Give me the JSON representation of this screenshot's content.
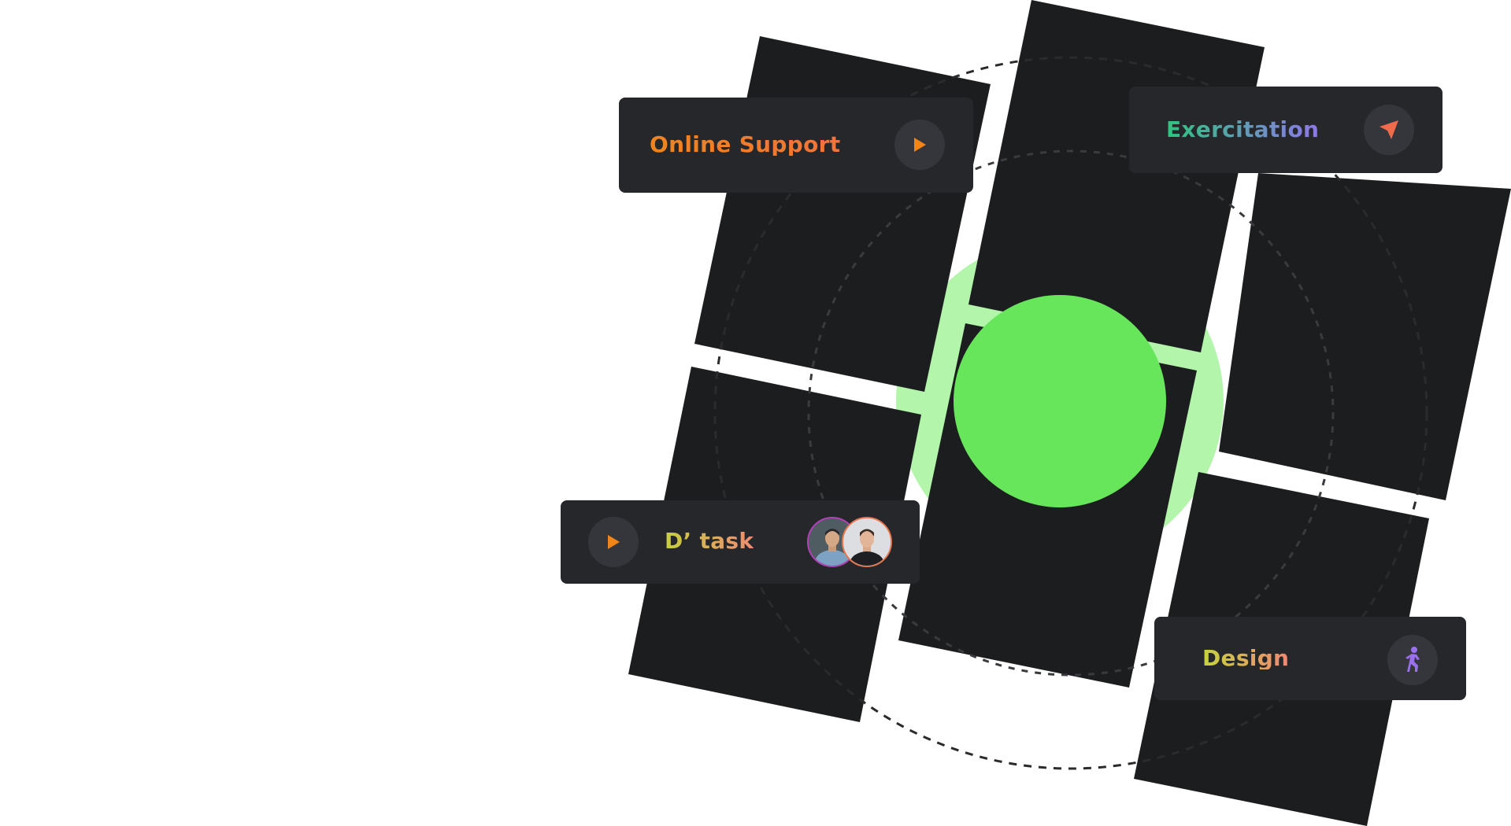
{
  "cards": {
    "online_support": {
      "label": "Online Support",
      "icon": "play-icon"
    },
    "exercitation": {
      "label": "Exercitation",
      "icon": "send-arrow-icon"
    },
    "d_task": {
      "label": "D’ task",
      "icon": "play-icon",
      "avatars": [
        "avatar-man-shirt",
        "avatar-man-dark"
      ]
    },
    "design": {
      "label": "Design",
      "icon": "running-figure-icon"
    }
  },
  "colors": {
    "panel_dark": "#1c1d1f",
    "card_bg": "#26272b",
    "green_outer": "#428438",
    "green_inner": "#67e65c",
    "green_light": "#b4f5ac",
    "accent_orange": "#f0851a",
    "accent_red": "#f06b4b",
    "accent_purple": "#9a6ff0"
  }
}
